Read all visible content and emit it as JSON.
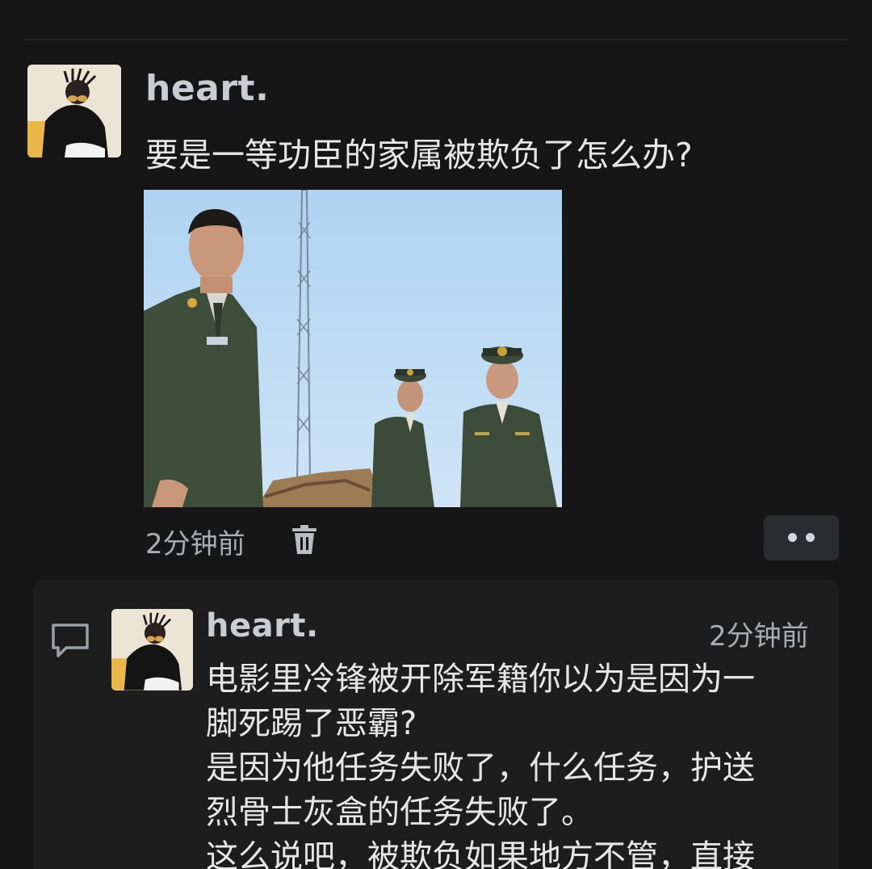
{
  "post": {
    "username": "heart.",
    "text": "要是一等功臣的家属被欺负了怎么办?",
    "timestamp": "2分钟前",
    "icons": {
      "avatar": "user-avatar",
      "delete": "trash-icon",
      "more": "more-dots-icon"
    }
  },
  "reply": {
    "username": "heart.",
    "timestamp": "2分钟前",
    "lines": [
      "电影里冷锋被开除军籍你以为是因为一",
      "脚死踢了恶霸?",
      "是因为他任务失败了，什么任务，护送",
      "烈骨士灰盒的任务失败了。",
      "这么说吧，被欺负如果地方不管，直接"
    ],
    "icons": {
      "comment": "comment-icon",
      "avatar": "user-avatar"
    }
  },
  "colors": {
    "background": "#161616",
    "card": "#1d1d1e",
    "username": "#c9ccd1",
    "text": "#e6e6e6",
    "muted": "#a9acb0"
  }
}
